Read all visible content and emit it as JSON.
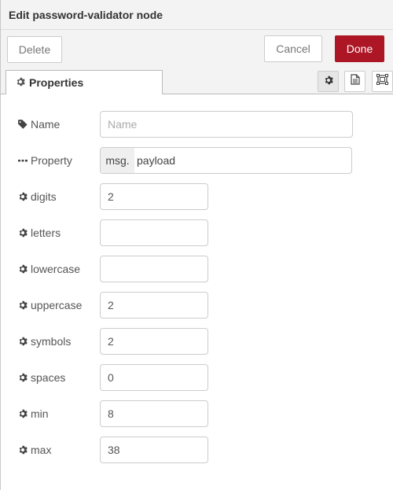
{
  "header": {
    "title": "Edit password-validator node"
  },
  "toolbar": {
    "delete_label": "Delete",
    "cancel_label": "Cancel",
    "done_label": "Done"
  },
  "tabs": {
    "properties_label": "Properties",
    "icons": [
      "gear-icon",
      "description-icon",
      "appearance-icon"
    ]
  },
  "form": {
    "name": {
      "label": "Name",
      "value": "",
      "placeholder": "Name",
      "icon": "tag-icon"
    },
    "property": {
      "label": "Property",
      "prefix": "msg.",
      "value": "payload",
      "icon": "ellipsis-icon"
    },
    "digits": {
      "label": "digits",
      "value": "2"
    },
    "letters": {
      "label": "letters",
      "value": ""
    },
    "lowercase": {
      "label": "lowercase",
      "value": ""
    },
    "uppercase": {
      "label": "uppercase",
      "value": "2"
    },
    "symbols": {
      "label": "symbols",
      "value": "2"
    },
    "spaces": {
      "label": "spaces",
      "value": "0"
    },
    "min": {
      "label": "min",
      "value": "8"
    },
    "max": {
      "label": "max",
      "value": "38"
    }
  },
  "colors": {
    "done_bg": "#ad1625",
    "header_bg": "#f3f3f3",
    "prefix_bg": "#efefef"
  }
}
